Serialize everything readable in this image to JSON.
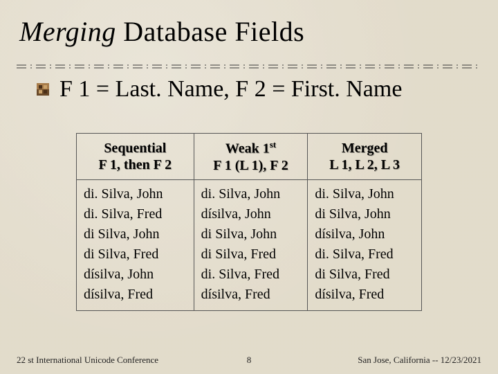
{
  "title_em": "Merging",
  "title_rest": " Database Fields",
  "bullet": "F 1 = Last. Name, F 2 = First. Name",
  "table": {
    "headers": [
      {
        "l1": "Sequential",
        "l2": "F 1, then F 2"
      },
      {
        "l1": "Weak 1",
        "sup": "st",
        "l2": "F 1 (L 1), F 2"
      },
      {
        "l1": "Merged",
        "l2": "L 1, L 2, L 3"
      }
    ],
    "rows": [
      [
        "di. Silva, John",
        "di. Silva, John",
        "di. Silva, John"
      ],
      [
        "di. Silva, Fred",
        "dísilva, John",
        "di Silva, John"
      ],
      [
        "di Silva, John",
        "di Silva, John",
        "dísilva, John"
      ],
      [
        "di Silva, Fred",
        "di Silva, Fred",
        "di. Silva, Fred"
      ],
      [
        "dísilva, John",
        "di. Silva, Fred",
        "di Silva, Fred"
      ],
      [
        "dísilva, Fred",
        "dísilva, Fred",
        "dísilva, Fred"
      ]
    ]
  },
  "footer_left": "22 st International Unicode Conference",
  "footer_center": "8",
  "footer_right": "San Jose, California -- 12/23/2021"
}
